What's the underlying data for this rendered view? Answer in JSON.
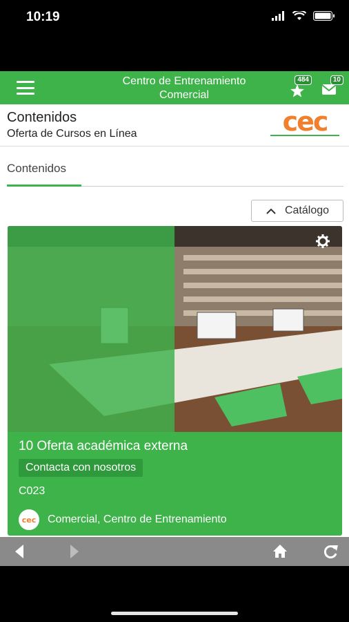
{
  "status": {
    "time": "10:19"
  },
  "header": {
    "title_line1": "Centro de Entrenamiento",
    "title_line2": "Comercial",
    "points_badge": "484",
    "mail_badge": "10",
    "accent": "#3db34a"
  },
  "page": {
    "title": "Contenidos",
    "subtitle": "Oferta de Cursos en Línea",
    "logo_text": "cec"
  },
  "tabs": [
    {
      "label": "Contenidos",
      "active": true
    }
  ],
  "catalog_button": {
    "label": "Catálogo"
  },
  "card": {
    "title": "10 Oferta académica externa",
    "tag": "Contacta con nosotros",
    "code": "C023",
    "author": "Comercial, Centro de Entrenamiento"
  },
  "icons": {
    "menu": "hamburger-icon",
    "points": "star-icon",
    "mail": "envelope-icon",
    "settings": "gear-icon",
    "back": "back-arrow-icon",
    "forward": "forward-arrow-icon",
    "home": "home-icon",
    "refresh": "refresh-icon"
  }
}
